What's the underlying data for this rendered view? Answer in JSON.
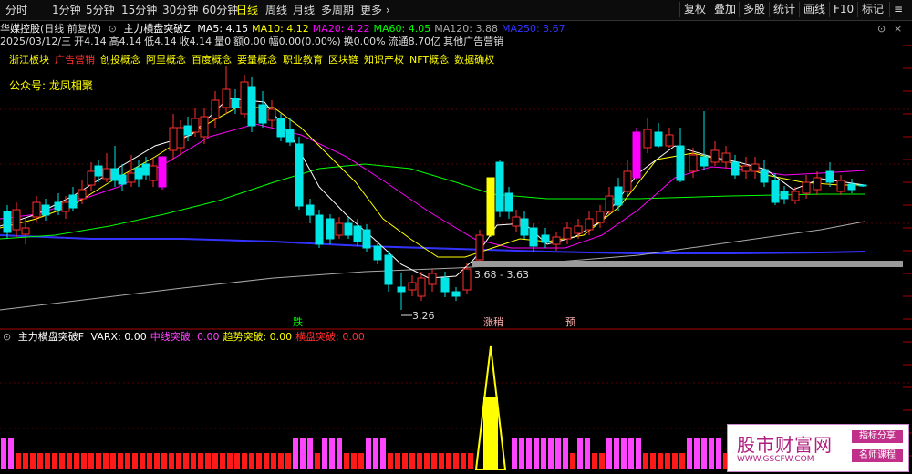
{
  "toolbar": {
    "periods": [
      "分时",
      "1分钟",
      "5分钟",
      "15分钟",
      "30分钟",
      "60分钟",
      "日线",
      "周线",
      "月线",
      "多周期",
      "更多"
    ],
    "active_period": "日线",
    "tools": [
      "复权",
      "叠加",
      "多股",
      "统计",
      "画线",
      "F10",
      "标记"
    ]
  },
  "header": {
    "stock_name": "华媒控股",
    "mode": "(日线 前复权)",
    "indicator_name": "主力横盘突破Z",
    "ma_items": [
      {
        "label": "MA5: 4.15",
        "color": "#ffffff"
      },
      {
        "label": "MA10: 4.12",
        "color": "#ffff00"
      },
      {
        "label": "MA20: 4.22",
        "color": "#ff00ff"
      },
      {
        "label": "MA60: 4.05",
        "color": "#00ff00"
      },
      {
        "label": "MA120: 3.88",
        "color": "#aaaaaa"
      },
      {
        "label": "MA250: 3.67",
        "color": "#3333ff"
      }
    ],
    "quote_parts": [
      "2025/03/12/三",
      "开4.14",
      "高4.14",
      "低4.14",
      "收4.14",
      "量0",
      "额0.00",
      "幅0.00(0.00%)",
      "换0.00%",
      "流通8.70亿",
      "其他广告营销"
    ]
  },
  "concepts": [
    {
      "label": "浙江板块",
      "color": "#ffff00"
    },
    {
      "label": "广告营销",
      "color": "#ff3030"
    },
    {
      "label": "创投概念",
      "color": "#ffff00"
    },
    {
      "label": "阿里概念",
      "color": "#ffff00"
    },
    {
      "label": "百度概念",
      "color": "#ffff00"
    },
    {
      "label": "要量概念",
      "color": "#ffff00"
    },
    {
      "label": "职业教育",
      "color": "#ffff00"
    },
    {
      "label": "区块链",
      "color": "#ffff00"
    },
    {
      "label": "知识产权",
      "color": "#ffff00"
    },
    {
      "label": "NFT概念",
      "color": "#ffff00"
    },
    {
      "label": "数据确权",
      "color": "#ffff00"
    }
  ],
  "wechat": "公众号: 龙凤相聚",
  "annotations": {
    "low_price": "3.26",
    "box_range": "3.68 - 3.63",
    "signal_die": "跌",
    "signal_limit": "涨稍",
    "signal_yu": "预"
  },
  "sub_header": {
    "name": "主力横盘突破F",
    "items": [
      {
        "label": "VARX: 0.00",
        "color": "#ffffff"
      },
      {
        "label": "中线突破: 0.00",
        "color": "#ff44ff"
      },
      {
        "label": "趋势突破: 0.00",
        "color": "#ffff00"
      },
      {
        "label": "横盘突破: 0.00",
        "color": "#ff3030"
      }
    ]
  },
  "watermark": {
    "title": "股市财富网",
    "url": "WWW.GSCFW.COM",
    "tag1": "指标分享",
    "tag2": "名师课程"
  },
  "colors": {
    "up": "#ff3030",
    "down": "#00e5e5",
    "ma5": "#ffffff",
    "ma10": "#ffff00",
    "ma20": "#ff00ff",
    "ma60": "#00ff00",
    "ma120": "#aaaaaa",
    "ma250": "#3333ff"
  }
}
